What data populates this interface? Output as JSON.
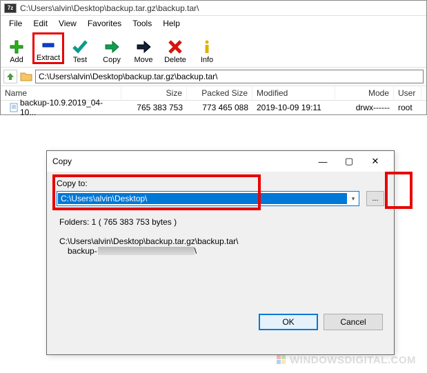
{
  "titlebar": {
    "app_badge": "7z",
    "path": "C:\\Users\\alvin\\Desktop\\backup.tar.gz\\backup.tar\\"
  },
  "menubar": {
    "file": "File",
    "edit": "Edit",
    "view": "View",
    "favorites": "Favorites",
    "tools": "Tools",
    "help": "Help"
  },
  "toolbar": {
    "add": "Add",
    "extract": "Extract",
    "test": "Test",
    "copy": "Copy",
    "move": "Move",
    "delete": "Delete",
    "info": "Info"
  },
  "navbar": {
    "path": "C:\\Users\\alvin\\Desktop\\backup.tar.gz\\backup.tar\\"
  },
  "columns": {
    "name": "Name",
    "size": "Size",
    "packed": "Packed Size",
    "modified": "Modified",
    "mode": "Mode",
    "user": "User"
  },
  "rows": [
    {
      "name": "backup-10.9.2019_04-10...",
      "size": "765 383 753",
      "packed": "773 465 088",
      "modified": "2019-10-09 19:11",
      "mode": "drwx------",
      "user": "root"
    }
  ],
  "dialog": {
    "title": "Copy",
    "copy_to_label": "Copy to:",
    "copy_to_value": "C:\\Users\\alvin\\Desktop\\",
    "browse_label": "...",
    "folders_line": "Folders: 1    ( 765 383 753 bytes )",
    "path_line": "C:\\Users\\alvin\\Desktop\\backup.tar.gz\\backup.tar\\",
    "backup_prefix": "backup-",
    "ok": "OK",
    "cancel": "Cancel",
    "minimize": "—",
    "maximize": "▢",
    "close": "✕"
  },
  "watermark": "WINDOWSDIGITAL.COM"
}
